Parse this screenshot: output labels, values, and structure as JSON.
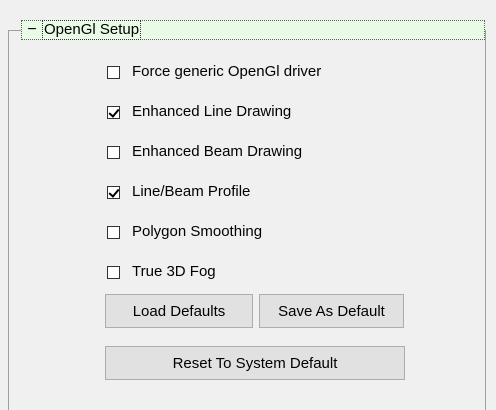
{
  "group": {
    "title": "OpenGl Setup",
    "collapse_glyph": "−"
  },
  "options": [
    {
      "label": "Force generic OpenGl driver",
      "checked": false
    },
    {
      "label": "Enhanced Line Drawing",
      "checked": true
    },
    {
      "label": "Enhanced Beam Drawing",
      "checked": false
    },
    {
      "label": "Line/Beam Profile",
      "checked": true
    },
    {
      "label": "Polygon Smoothing",
      "checked": false
    },
    {
      "label": "True 3D Fog",
      "checked": false
    }
  ],
  "buttons": {
    "load_defaults": "Load Defaults",
    "save_as_default": "Save As Default",
    "reset_system_default": "Reset To System Default"
  }
}
